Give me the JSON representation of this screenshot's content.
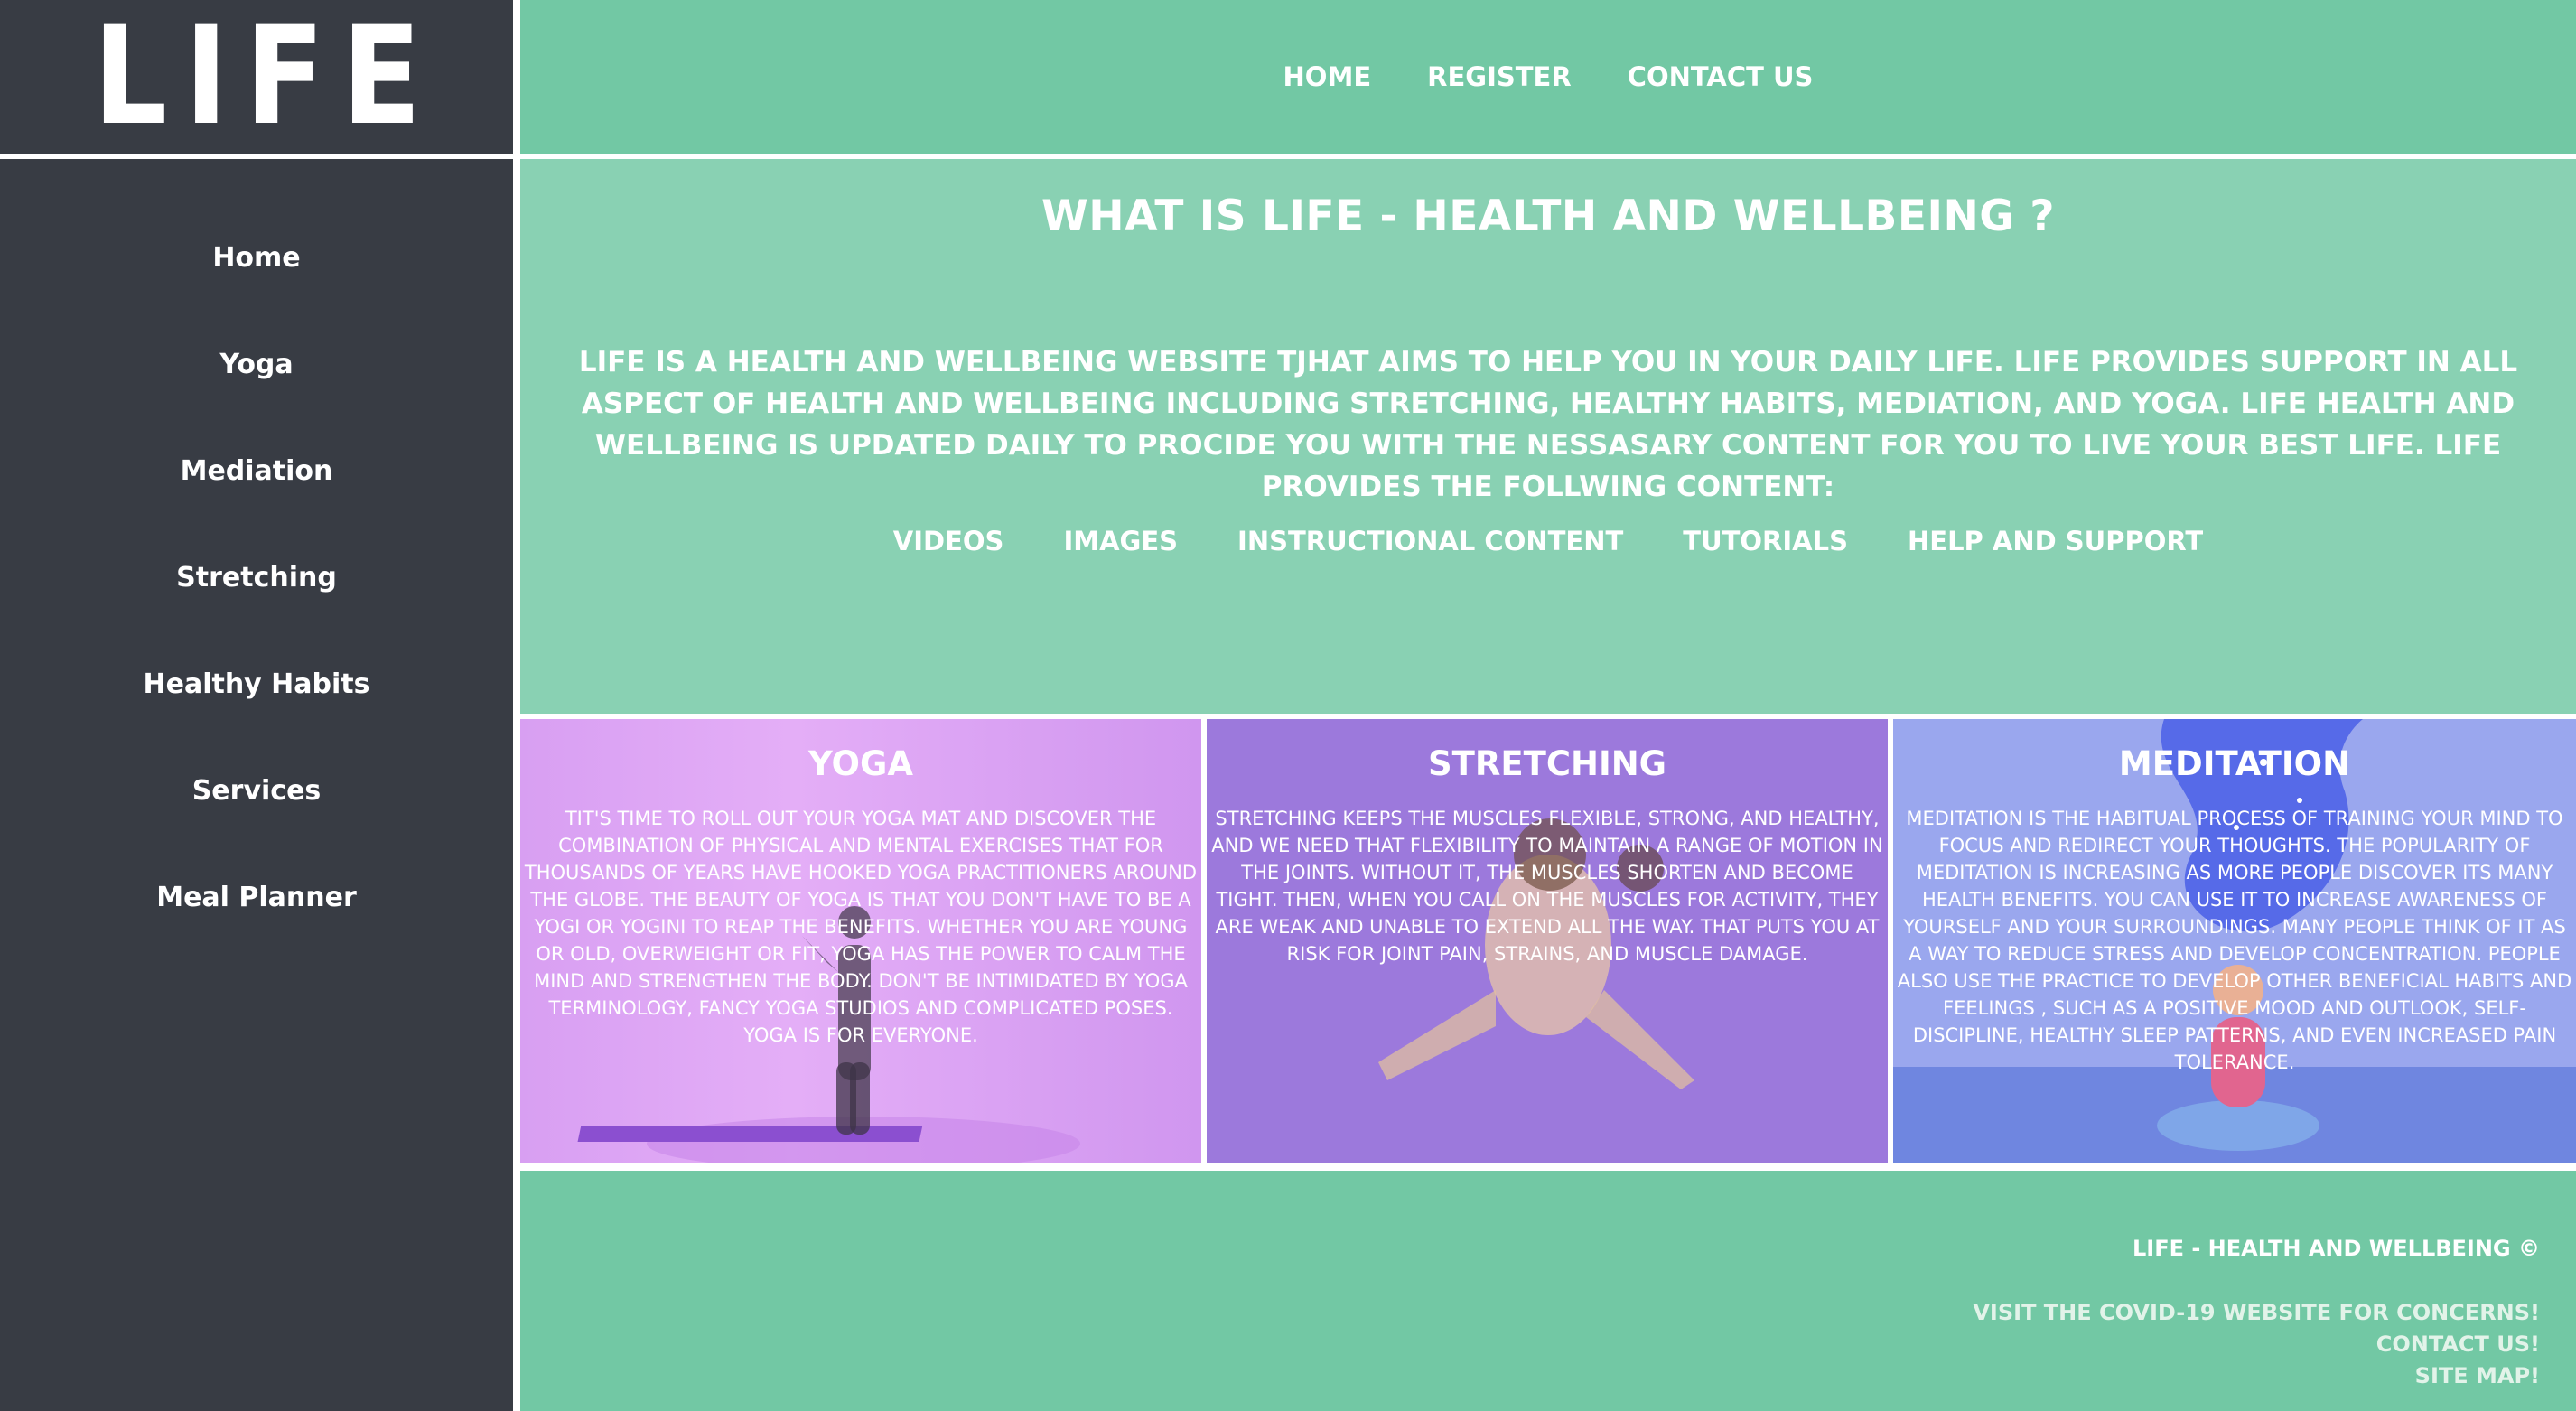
{
  "logo": {
    "text": "LIFE"
  },
  "topnav": {
    "items": [
      "HOME",
      "REGISTER",
      "CONTACT US"
    ]
  },
  "sidebar": {
    "items": [
      "Home",
      "Yoga",
      "Mediation",
      "Stretching",
      "Healthy Habits",
      "Services",
      "Meal Planner"
    ]
  },
  "intro": {
    "title": "WHAT IS LIFE - HEALTH AND WELLBEING ?",
    "body": "LIFE IS A HEALTH AND WELLBEING WEBSITE TJHAT AIMS TO HELP YOU IN YOUR DAILY LIFE. LIFE PROVIDES SUPPORT IN ALL ASPECT OF HEALTH AND WELLBEING INCLUDING STRETCHING, HEALTHY HABITS, MEDIATION, AND YOGA. LIFE HEALTH AND WELLBEING IS UPDATED DAILY TO PROCIDE YOU WITH THE NESSASARY CONTENT FOR YOU TO LIVE YOUR BEST LIFE. LIFE PROVIDES THE FOLLWING CONTENT:",
    "content_links": [
      "VIDEOS",
      "IMAGES",
      "INSTRUCTIONAL CONTENT",
      "TUTORIALS",
      "HELP AND SUPPORT"
    ]
  },
  "cards": {
    "yoga": {
      "title": "YOGA",
      "text": "TIT'S TIME TO ROLL OUT YOUR YOGA MAT AND DISCOVER THE COMBINATION OF PHYSICAL AND MENTAL EXERCISES THAT FOR THOUSANDS OF YEARS HAVE HOOKED YOGA PRACTITIONERS AROUND THE GLOBE. THE BEAUTY OF YOGA IS THAT YOU DON'T HAVE TO BE A YOGI OR YOGINI TO REAP THE BENEFITS. WHETHER YOU ARE YOUNG OR OLD, OVERWEIGHT OR FIT, YOGA HAS THE POWER TO CALM THE MIND AND STRENGTHEN THE BODY. DON'T BE INTIMIDATED BY YOGA TERMINOLOGY, FANCY YOGA STUDIOS AND COMPLICATED POSES. YOGA IS FOR EVERYONE."
    },
    "stretching": {
      "title": "STRETCHING",
      "text": "STRETCHING KEEPS THE MUSCLES FLEXIBLE, STRONG, AND HEALTHY, AND WE NEED THAT FLEXIBILITY TO MAINTAIN A RANGE OF MOTION IN THE JOINTS. WITHOUT IT, THE MUSCLES SHORTEN AND BECOME TIGHT. THEN, WHEN YOU CALL ON THE MUSCLES FOR ACTIVITY, THEY ARE WEAK AND UNABLE TO EXTEND ALL THE WAY. THAT PUTS YOU AT RISK FOR JOINT PAIN, STRAINS, AND MUSCLE DAMAGE."
    },
    "meditation": {
      "title": "MEDITATION",
      "text": "MEDITATION IS THE HABITUAL PROCESS OF TRAINING YOUR MIND TO FOCUS AND REDIRECT YOUR THOUGHTS. THE POPULARITY OF MEDITATION IS INCREASING AS MORE PEOPLE DISCOVER ITS MANY HEALTH BENEFITS. YOU CAN USE IT TO INCREASE AWARENESS OF YOURSELF AND YOUR SURROUNDINGS. MANY PEOPLE THINK OF IT AS A WAY TO REDUCE STRESS AND DEVELOP CONCENTRATION. PEOPLE ALSO USE THE PRACTICE TO DEVELOP OTHER BENEFICIAL HABITS AND FEELINGS , SUCH AS A POSITIVE MOOD AND OUTLOOK, SELF-DISCIPLINE, HEALTHY SLEEP PATTERNS, AND EVEN INCREASED PAIN TOLERANCE."
    }
  },
  "footer": {
    "copyright": "LIFE - HEALTH AND WELLBEING ©",
    "links": [
      "VISIT THE COVID-19 WEBSITE FOR CONCERNS!",
      "CONTACT US!",
      "SITE MAP!"
    ]
  },
  "colors": {
    "sidebar_bg": "#383c44",
    "header_green": "#72c8a4",
    "intro_green": "#89d1b3",
    "yoga_pink": "#e4aef7",
    "stretch_purple": "#9c79dc",
    "meditation_blue": "#9aa7ee"
  }
}
